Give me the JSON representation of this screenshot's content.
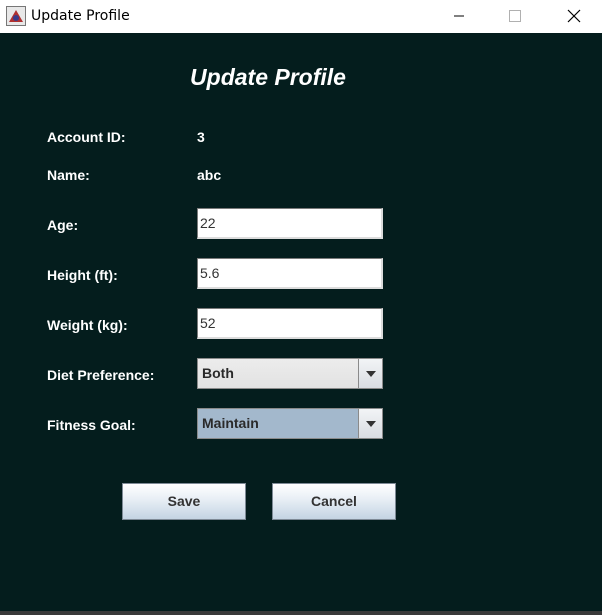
{
  "window": {
    "title": "Update Profile"
  },
  "form": {
    "heading": "Update Profile",
    "account_id_label": "Account ID:",
    "account_id_value": "3",
    "name_label": "Name:",
    "name_value": "abc",
    "age_label": "Age:",
    "age_value": "22",
    "height_label": "Height (ft):",
    "height_value": "5.6",
    "weight_label": "Weight (kg):",
    "weight_value": "52",
    "diet_label": "Diet Preference:",
    "diet_selected": "Both",
    "goal_label": "Fitness Goal:",
    "goal_selected": "Maintain"
  },
  "buttons": {
    "save_label": "Save",
    "cancel_label": "Cancel"
  },
  "icons": {
    "app": "java-app-icon",
    "minimize": "minimize-icon",
    "maximize": "maximize-icon",
    "close": "close-icon",
    "dropdown": "chevron-down-icon"
  },
  "colors": {
    "background": "#041d1d",
    "text": "#ffffff",
    "goal_combo": "#a3b8cc"
  }
}
